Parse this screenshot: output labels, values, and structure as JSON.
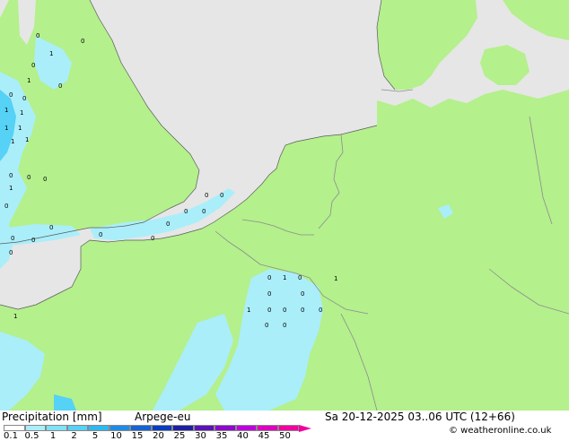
{
  "map": {
    "colors": {
      "sea": "#e6e6e6",
      "land_no_precip": "#b4f08c",
      "land_outside": "#dcdcdc",
      "precip_light": "#aaeefa",
      "precip_medium": "#55d2f5",
      "border": "#8c8c8c"
    },
    "precip_labels": [
      "0",
      "0",
      "1",
      "0",
      "1",
      "0",
      "0",
      "0",
      "1",
      "1",
      "1",
      "1",
      "1",
      "1",
      "0",
      "0",
      "0",
      "1",
      "0",
      "0",
      "0",
      "0",
      "0",
      "0",
      "0",
      "0",
      "0",
      "0",
      "0",
      "0",
      "0",
      "1",
      "0",
      "1",
      "0",
      "0",
      "0",
      "0",
      "0",
      "1",
      "0",
      "1",
      "0",
      "0"
    ]
  },
  "footer": {
    "title": "Precipitation [mm]",
    "model": "Arpege-eu",
    "datetime": "Sa 20-12-2025 03..06 UTC (12+66)",
    "copyright": "© weatheronline.co.uk",
    "legend": {
      "ticks": [
        "0.1",
        "0.5",
        "1",
        "2",
        "5",
        "10",
        "15",
        "20",
        "25",
        "30",
        "35",
        "40",
        "45",
        "50"
      ],
      "colors": [
        "#ffffff",
        "#aaeefa",
        "#80e1f7",
        "#55d2f5",
        "#2db9f0",
        "#1e8ce6",
        "#1464d2",
        "#0a3cbe",
        "#1e1ea0",
        "#5a14b4",
        "#8c0ac8",
        "#be00dc",
        "#dc00be",
        "#f000a0"
      ]
    }
  }
}
